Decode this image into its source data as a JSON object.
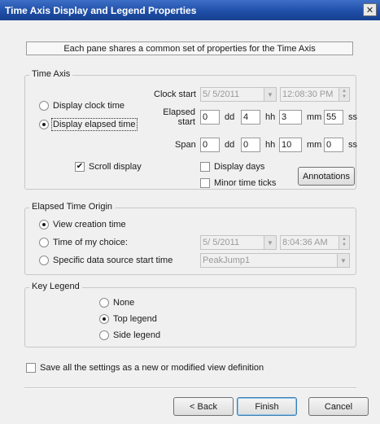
{
  "window": {
    "title": "Time Axis Display and Legend Properties",
    "close_glyph": "✕"
  },
  "banner": "Each pane shares a common set of properties for the Time Axis",
  "time_axis": {
    "legend": "Time Axis",
    "display_clock_time": "Display clock time",
    "display_elapsed_time": "Display elapsed time",
    "selected": "display_elapsed_time",
    "clock_start_label": "Clock start",
    "clock_start_date": "5/  5/2011",
    "clock_start_time": "12:08:30 PM",
    "elapsed_start_label": "Elapsed start",
    "elapsed_start": {
      "dd": "0",
      "hh": "4",
      "mm": "3",
      "ss": "55"
    },
    "span_label": "Span",
    "span": {
      "dd": "0",
      "hh": "0",
      "mm": "10",
      "ss": "0"
    },
    "units": {
      "dd": "dd",
      "hh": "hh",
      "mm": "mm",
      "ss": "ss"
    },
    "scroll_display": "Scroll display",
    "scroll_display_checked": true,
    "display_days": "Display days",
    "display_days_checked": false,
    "minor_time_ticks": "Minor time ticks",
    "minor_time_ticks_checked": false,
    "annotations_button": "Annotations"
  },
  "elapsed_origin": {
    "legend": "Elapsed Time Origin",
    "view_creation_time": "View creation time",
    "time_of_my_choice": "Time of my choice:",
    "specific_source_start": "Specific data source start time",
    "selected": "view_creation_time",
    "choice_date": "5/  5/2011",
    "choice_time": "8:04:36 AM",
    "data_source": "PeakJump1"
  },
  "key_legend": {
    "legend": "Key Legend",
    "none": "None",
    "top_legend": "Top legend",
    "side_legend": "Side legend",
    "selected": "top_legend"
  },
  "save_settings": {
    "label": "Save all the settings as a new or modified view definition",
    "checked": false
  },
  "buttons": {
    "back": "< Back",
    "finish": "Finish",
    "cancel": "Cancel"
  },
  "check_glyph": "✔"
}
